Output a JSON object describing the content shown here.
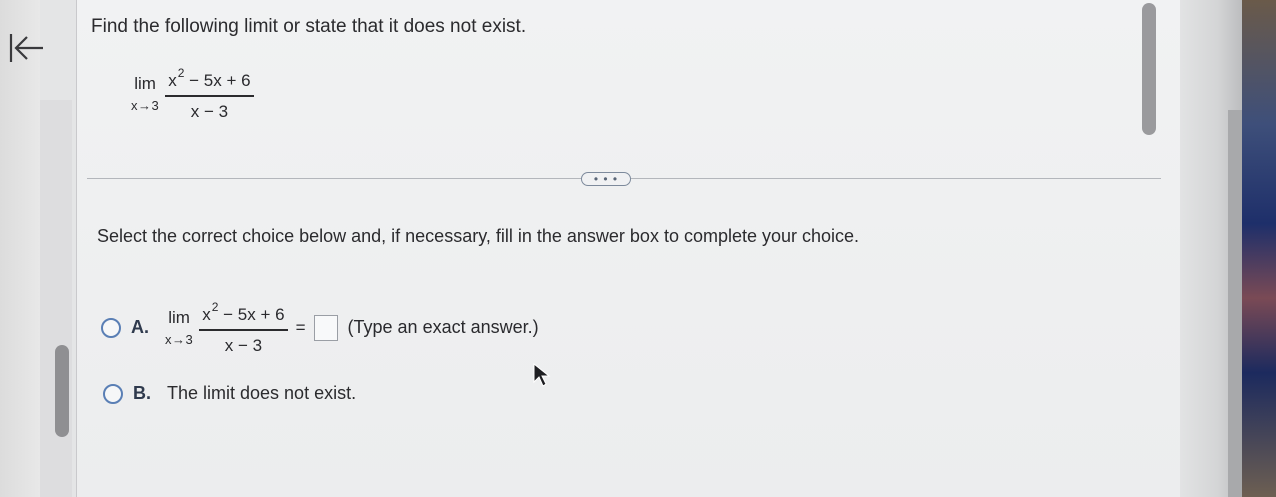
{
  "question": {
    "prompt": "Find the following limit or state that it does not exist.",
    "limit": {
      "lim": "lim",
      "approach": "x→3",
      "numerator_base": "x",
      "numerator_exp": "2",
      "numerator_rest": " − 5x + 6",
      "denominator": "x − 3"
    }
  },
  "more_button_label": "• • •",
  "instruction": "Select the correct choice below and, if necessary, fill in the answer box to complete your choice.",
  "choices": [
    {
      "letter": "A.",
      "lim": "lim",
      "approach": "x→3",
      "numerator_base": "x",
      "numerator_exp": "2",
      "numerator_rest": " − 5x + 6",
      "denominator": "x − 3",
      "equals": "=",
      "answer_value": "",
      "hint": "(Type an exact answer.)"
    },
    {
      "letter": "B.",
      "text": "The limit does not exist."
    }
  ],
  "icons": {
    "back": "arrow-left-bar-icon",
    "cursor": "mouse-pointer-icon"
  },
  "colors": {
    "radio_border": "#5a7fb5",
    "text": "#2b2b2e"
  }
}
